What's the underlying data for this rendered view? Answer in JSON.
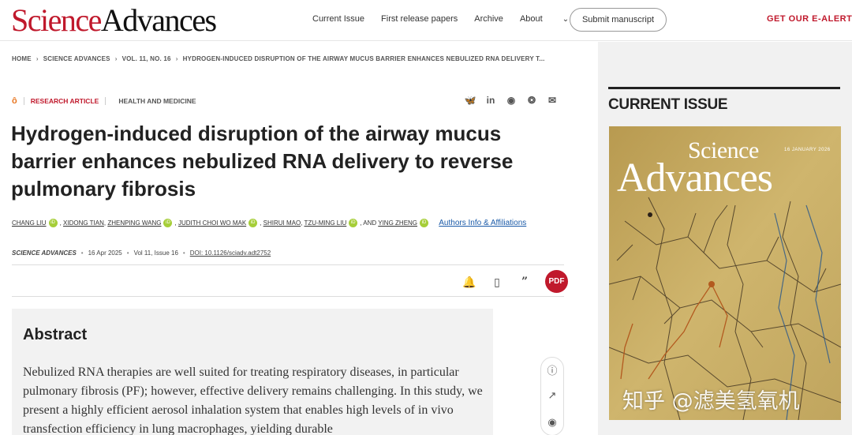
{
  "header": {
    "logo_science": "Science",
    "logo_advances": "Advances",
    "nav": [
      "Current Issue",
      "First release papers",
      "Archive",
      "About"
    ],
    "submit_label": "Submit manuscript",
    "ealerts_label": "GET OUR E-ALERTS"
  },
  "breadcrumb": [
    "HOME",
    "SCIENCE ADVANCES",
    "VOL. 11, NO. 16",
    "HYDROGEN-INDUCED DISRUPTION OF THE AIRWAY MUCUS BARRIER ENHANCES NEBULIZED RNA DELIVERY T..."
  ],
  "article": {
    "type": "RESEARCH ARTICLE",
    "topic": "HEALTH AND MEDICINE",
    "title": "Hydrogen-induced disruption of the airway mucus barrier enhances nebulized RNA delivery to reverse pulmonary fibrosis",
    "authors": [
      "CHANG LIU",
      "XIDONG TIAN",
      "ZHENPING WANG",
      "JUDITH CHOI WO MAK",
      "SHIRUI MAO",
      "TZU-MING LIU",
      "YING ZHENG"
    ],
    "and_word": "AND",
    "affiliations_link": "Authors Info & Affiliations",
    "journal": "SCIENCE ADVANCES",
    "date": "16 Apr 2025",
    "volume": "Vol 11, Issue 16",
    "doi": "DOI: 10.1126/sciadv.adt2752",
    "pdf_label": "PDF"
  },
  "abstract": {
    "heading": "Abstract",
    "text": "Nebulized RNA therapies are well suited for treating respiratory diseases, in particular pulmonary fibrosis (PF); however, effective delivery remains challenging. In this study, we present a highly efficient aerosol inhalation system that enables high levels of in vivo transfection efficiency in lung macrophages, yielding durable"
  },
  "sidebar": {
    "heading": "CURRENT ISSUE",
    "cover_science": "Science",
    "cover_advances": "Advances",
    "cover_date": "16 JANUARY 2026"
  },
  "watermark": "知乎 @滤美氢氧机",
  "icons": {
    "share": [
      "bluesky-icon",
      "linkedin-icon",
      "reddit-icon",
      "wechat-icon",
      "email-icon"
    ],
    "actions": [
      "bell-icon",
      "bookmark-icon",
      "quote-icon",
      "pdf-icon"
    ],
    "side": [
      "info-icon",
      "trend-icon",
      "eye-icon"
    ]
  },
  "colors": {
    "brand_red": "#c0192c",
    "orcid_green": "#a6ce39",
    "link_blue": "#1a5aa8",
    "open_access_orange": "#e87722"
  }
}
